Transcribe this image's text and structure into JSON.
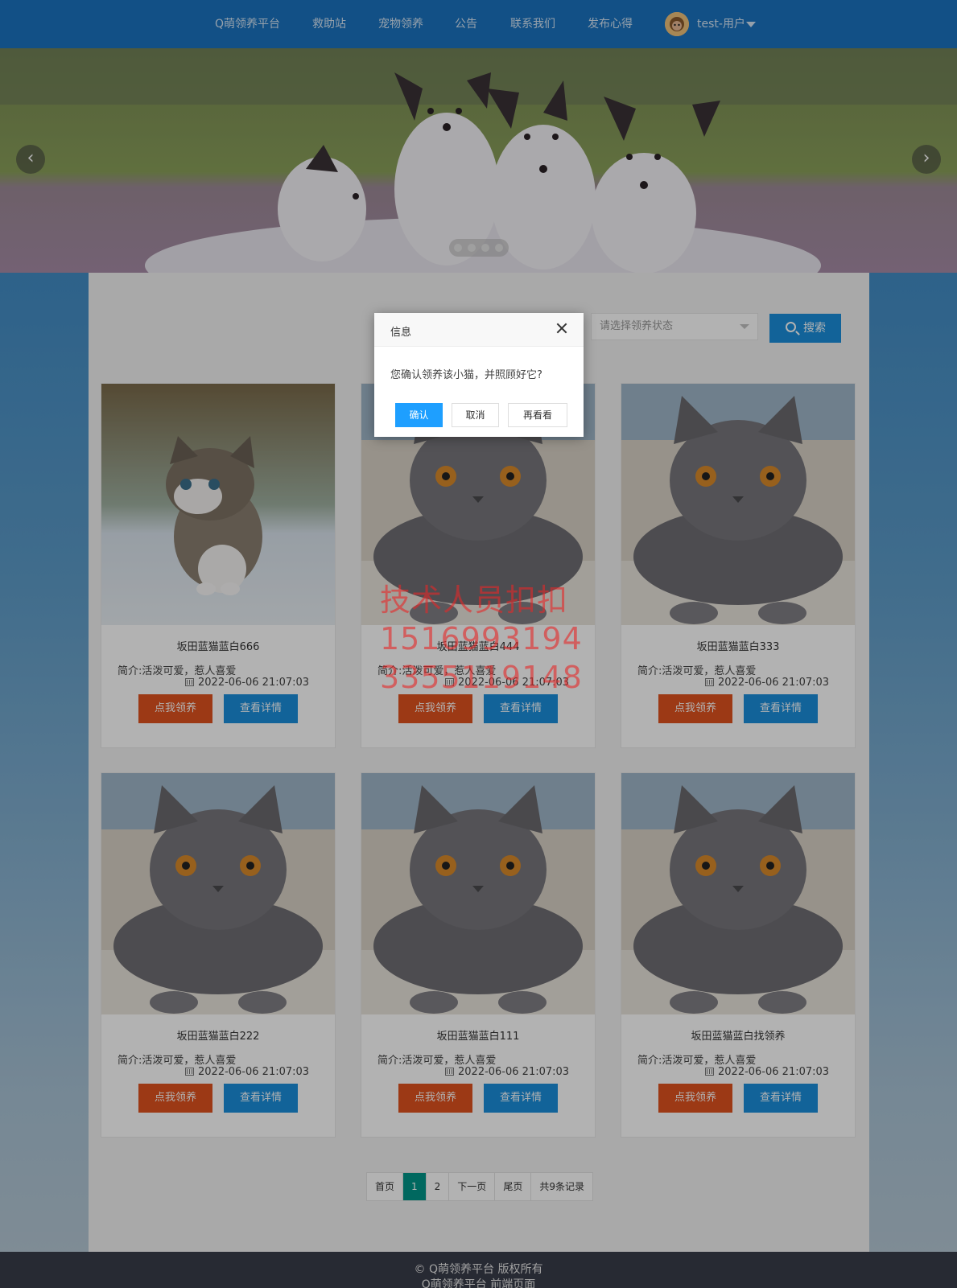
{
  "nav": {
    "items": [
      "Q萌领养平台",
      "救助站",
      "宠物领养",
      "公告",
      "联系我们",
      "发布心得"
    ],
    "user": "test-用户"
  },
  "search": {
    "status_placeholder": "请选择领养状态",
    "button": "搜索"
  },
  "cards": [
    {
      "title": "坂田蓝猫蓝白666",
      "desc": "简介:活泼可爱，惹人喜爱",
      "date": "2022-06-06 21:07:03",
      "adopt": "点我领养",
      "detail": "查看详情",
      "photo": "kitten"
    },
    {
      "title": "坂田蓝猫蓝白444",
      "desc": "简介:活泼可爱，惹人喜爱",
      "date": "2022-06-06 21:07:03",
      "adopt": "点我领养",
      "detail": "查看详情",
      "photo": "grey-cat"
    },
    {
      "title": "坂田蓝猫蓝白333",
      "desc": "简介:活泼可爱，惹人喜爱",
      "date": "2022-06-06 21:07:03",
      "adopt": "点我领养",
      "detail": "查看详情",
      "photo": "grey-cat"
    },
    {
      "title": "坂田蓝猫蓝白222",
      "desc": "简介:活泼可爱，惹人喜爱",
      "date": "2022-06-06 21:07:03",
      "adopt": "点我领养",
      "detail": "查看详情",
      "photo": "grey-cat"
    },
    {
      "title": "坂田蓝猫蓝白111",
      "desc": "简介:活泼可爱，惹人喜爱",
      "date": "2022-06-06 21:07:03",
      "adopt": "点我领养",
      "detail": "查看详情",
      "photo": "grey-cat"
    },
    {
      "title": "坂田蓝猫蓝白找领养",
      "desc": "简介:活泼可爱，惹人喜爱",
      "date": "2022-06-06 21:07:03",
      "adopt": "点我领养",
      "detail": "查看详情",
      "photo": "grey-cat"
    }
  ],
  "pager": {
    "first": "首页",
    "pages": [
      "1",
      "2"
    ],
    "current": "1",
    "next": "下一页",
    "last": "尾页",
    "total": "共9条记录"
  },
  "footer": {
    "copyright": "© Q萌领养平台 版权所有",
    "subtitle": "Q萌领养平台 前端页面"
  },
  "dialog": {
    "title": "信息",
    "message": "您确认领养该小猫，并照顾好它?",
    "confirm": "确认",
    "cancel": "取消",
    "later": "再看看"
  },
  "watermark": [
    "技术人员扣扣",
    "1516993194",
    "3355119148"
  ],
  "colors": {
    "nav": "#1a73c0",
    "adopt": "#e0521f",
    "detail": "#1a8fdc",
    "pager_active": "#009688",
    "dialog_primary": "#1e9fff"
  }
}
